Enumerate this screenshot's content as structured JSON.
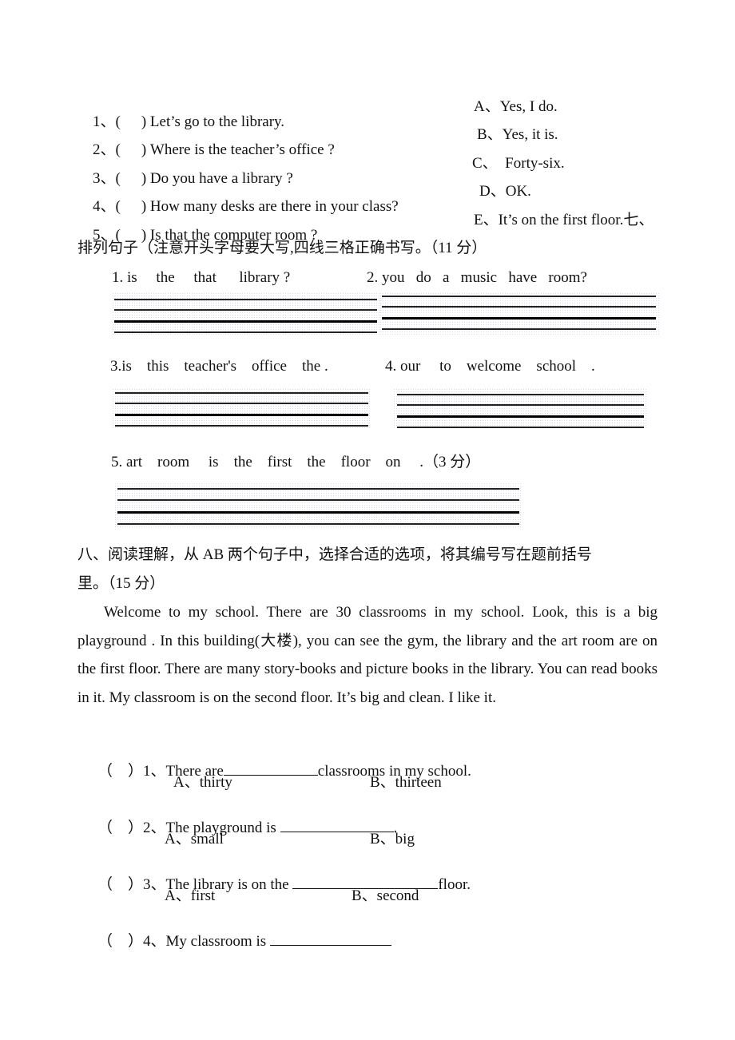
{
  "matching": {
    "questions": [
      {
        "num": "1、(",
        "close": ")",
        "text": "Let’s go to the library."
      },
      {
        "num": "2、(",
        "close": ")",
        "text": "Where is the teacher’s office ?"
      },
      {
        "num": "3、(",
        "close": ")",
        "text": "Do you have a library ?"
      },
      {
        "num": "4、(",
        "close": ")",
        "text": "How many desks are there in your class?"
      },
      {
        "num": "5、(",
        "close": ")",
        "text": "Is that the computer room ?"
      }
    ],
    "answers": [
      "A、Yes, I do.",
      "B、Yes, it is.",
      "C、  Forty-six.",
      "D、OK.",
      "E、It’s on the first floor.七、"
    ]
  },
  "section7": {
    "heading": "排列句子（注意开头字母要大写,四线三格正确书写。（11 分）",
    "items": [
      {
        "label": "1. is     the     that      library ?"
      },
      {
        "label": "2. you   do   a   music   have   room?"
      },
      {
        "label": "3.is    this    teacher's    office    the ."
      },
      {
        "label": "4. our     to    welcome    school    ."
      },
      {
        "label": "5. art    room     is    the    first    the    floor    on     .（3 分）"
      }
    ]
  },
  "section8": {
    "heading_line1": "八、阅读理解，从 AB 两个句子中，选择合适的选项，将其编号写在题前括号",
    "heading_line2": "里。（15 分）",
    "passage": "Welcome to my school. There are 30 classrooms in my school. Look, this is a big playground . In this building(大楼), you can see the gym, the library and the art room are on the first floor. There are many story-books and picture books in the library. You can read books in it. My classroom is on the second floor. It’s big and clean. I like it.",
    "questions": [
      {
        "bracket": "（    ）",
        "prefix": "1、There are",
        "suffix": "classrooms in my school.",
        "option_a": "A、thirty",
        "option_b": "B、thirteen"
      },
      {
        "bracket": "（    ）",
        "prefix": "2、The playground is ",
        "suffix": ".",
        "option_a": "A、small",
        "option_b": "B、big"
      },
      {
        "bracket": "（    ）",
        "prefix": "3、The library is on the ",
        "suffix": "floor.",
        "option_a": "A、first",
        "option_b": "B、second"
      },
      {
        "bracket": "（    ）",
        "prefix": "4、My classroom is ",
        "suffix": ""
      }
    ]
  }
}
